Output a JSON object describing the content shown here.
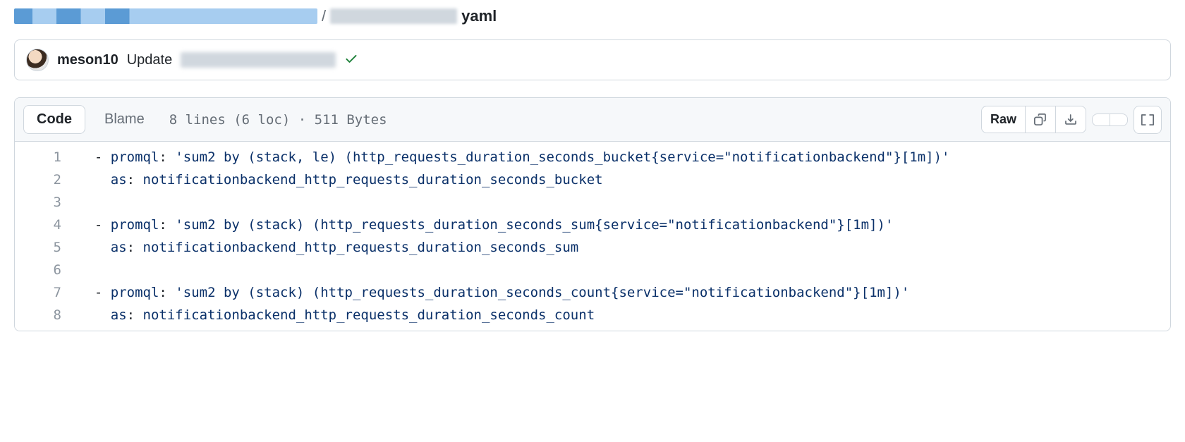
{
  "breadcrumb": {
    "sep": "/",
    "ext": "yaml"
  },
  "commit": {
    "author": "meson10",
    "message_prefix": "Update"
  },
  "file_header": {
    "tabs": {
      "code": "Code",
      "blame": "Blame"
    },
    "meta": "8 lines (6 loc) · 511 Bytes",
    "raw_label": "Raw"
  },
  "code": {
    "lines": [
      {
        "n": 1,
        "indent": "  ",
        "dash": true,
        "key": "promql",
        "value": "'sum2 by (stack, le) (http_requests_duration_seconds_bucket{service=\"notificationbackend\"}[1m])'",
        "quoted": true
      },
      {
        "n": 2,
        "indent": "    ",
        "dash": false,
        "key": "as",
        "value": "notificationbackend_http_requests_duration_seconds_bucket",
        "quoted": false
      },
      {
        "n": 3,
        "blank": true
      },
      {
        "n": 4,
        "indent": "  ",
        "dash": true,
        "key": "promql",
        "value": "'sum2 by (stack) (http_requests_duration_seconds_sum{service=\"notificationbackend\"}[1m])'",
        "quoted": true
      },
      {
        "n": 5,
        "indent": "    ",
        "dash": false,
        "key": "as",
        "value": "notificationbackend_http_requests_duration_seconds_sum",
        "quoted": false
      },
      {
        "n": 6,
        "blank": true
      },
      {
        "n": 7,
        "indent": "  ",
        "dash": true,
        "key": "promql",
        "value": "'sum2 by (stack) (http_requests_duration_seconds_count{service=\"notificationbackend\"}[1m])'",
        "quoted": true
      },
      {
        "n": 8,
        "indent": "    ",
        "dash": false,
        "key": "as",
        "value": "notificationbackend_http_requests_duration_seconds_count",
        "quoted": false
      }
    ]
  }
}
